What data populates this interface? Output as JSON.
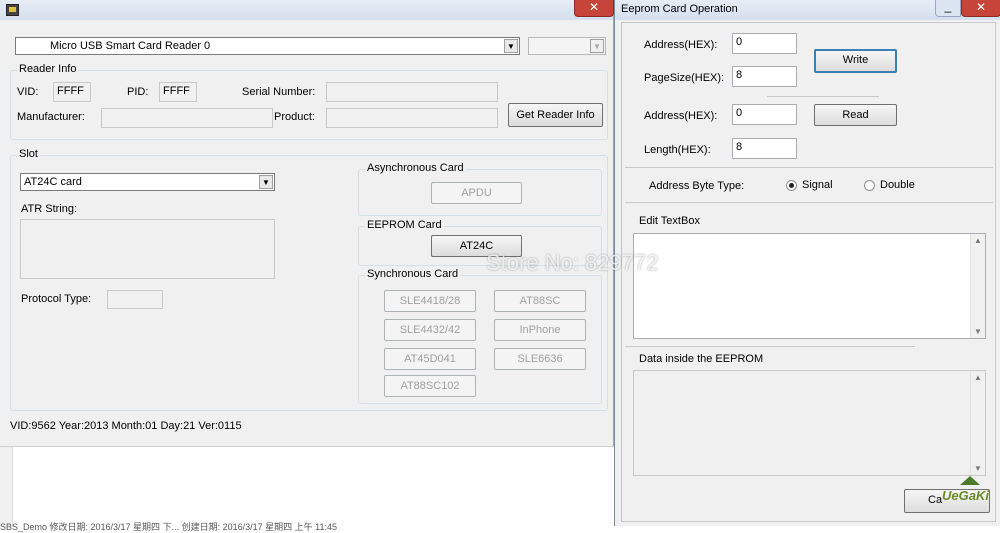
{
  "main_window": {
    "device_combo": "Micro USB Smart Card Reader 0",
    "reader_info": {
      "title": "Reader Info",
      "vid_label": "VID:",
      "vid_value": "FFFF",
      "pid_label": "PID:",
      "pid_value": "FFFF",
      "serial_label": "Serial Number:",
      "manufacturer_label": "Manufacturer:",
      "product_label": "Product:",
      "get_info_button": "Get Reader Info"
    },
    "slot": {
      "title": "Slot",
      "card_combo": "AT24C card",
      "atr_label": "ATR String:",
      "protocol_label": "Protocol Type:"
    },
    "async_card": {
      "title": "Asynchronous Card",
      "apdu_button": "APDU"
    },
    "eeprom_card": {
      "title": "EEPROM Card",
      "at24c_button": "AT24C"
    },
    "sync_card": {
      "title": "Synchronous Card",
      "buttons": [
        "SLE4418/28",
        "AT88SC",
        "SLE4432/42",
        "InPhone",
        "AT45D041",
        "SLE6636",
        "AT88SC102"
      ]
    },
    "status_text": "VID:9562 Year:2013 Month:01 Day:21 Ver:0115"
  },
  "taskbar_text": "SBS_Demo  修改日期: 2016/3/17 星期四 下...    创建日期: 2016/3/17 星期四 上午 11:45",
  "eeprom_window": {
    "title": "Eeprom Card Operation",
    "write_address_label": "Address(HEX):",
    "write_address_value": "0",
    "pagesize_label": "PageSize(HEX):",
    "pagesize_value": "8",
    "write_button": "Write",
    "read_address_label": "Address(HEX):",
    "read_address_value": "0",
    "length_label": "Length(HEX):",
    "length_value": "8",
    "read_button": "Read",
    "address_byte_label": "Address Byte Type:",
    "radio_signal": "Signal",
    "radio_double": "Double",
    "edit_textbox_label": "Edit TextBox",
    "data_inside_label": "Data inside the EEPROM",
    "cancel_button": "Ca"
  },
  "watermark": "Store No: 829772",
  "logo_text": "UeGaKi",
  "close_glyph": "✕",
  "min_glyph": "_"
}
